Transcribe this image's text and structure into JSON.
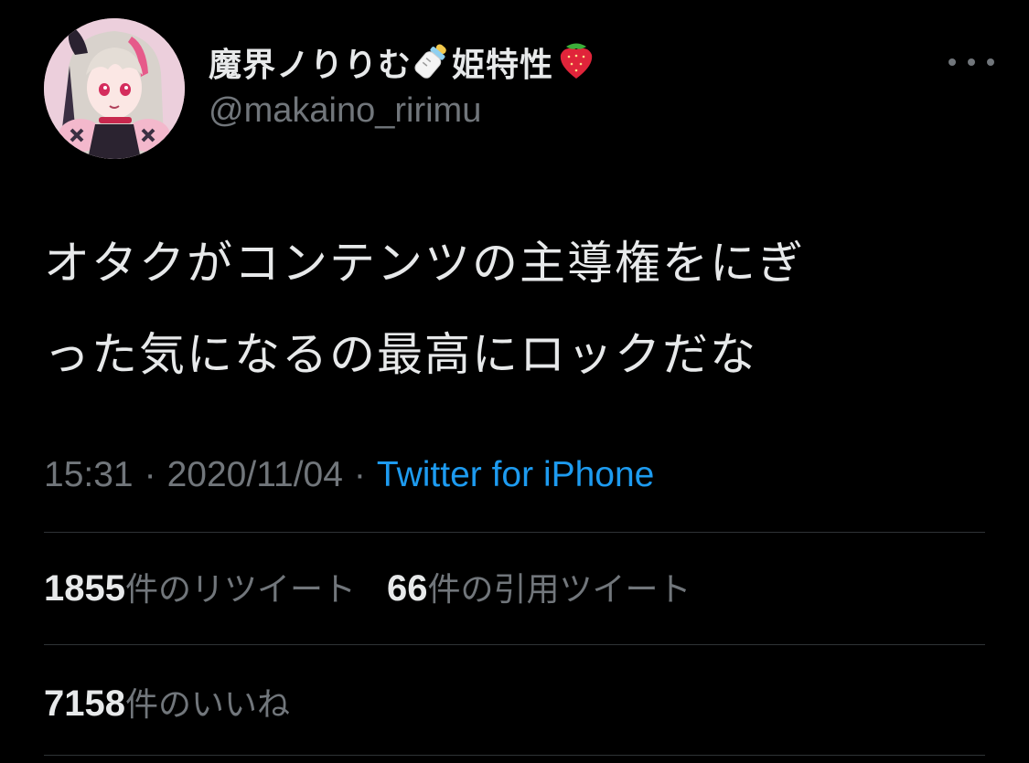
{
  "user": {
    "display_name": "魔界ノりりむ",
    "display_name_suffix": "姫特性",
    "handle": "@makaino_ririmu",
    "emoji_1": "baby-bottle-emoji",
    "emoji_2": "strawberry-emoji",
    "avatar": "avatar-image"
  },
  "tweet": {
    "text_line_1": "オタクがコンテンツの主導権をにぎ",
    "text_line_2": "った気になるの最高にロックだな",
    "time": "15:31",
    "date": "2020/11/04",
    "separator": "·",
    "source": "Twitter for iPhone"
  },
  "stats": {
    "retweets_count": "1855",
    "retweets_label": "件のリツイート",
    "quotes_count": "66",
    "quotes_label": "件の引用ツイート",
    "likes_count": "7158",
    "likes_label": "件のいいね"
  },
  "colors": {
    "background": "#000000",
    "primary_text": "#e7e9ea",
    "secondary_text": "#71767b",
    "link": "#1d9bf0",
    "divider": "#2f3336"
  }
}
